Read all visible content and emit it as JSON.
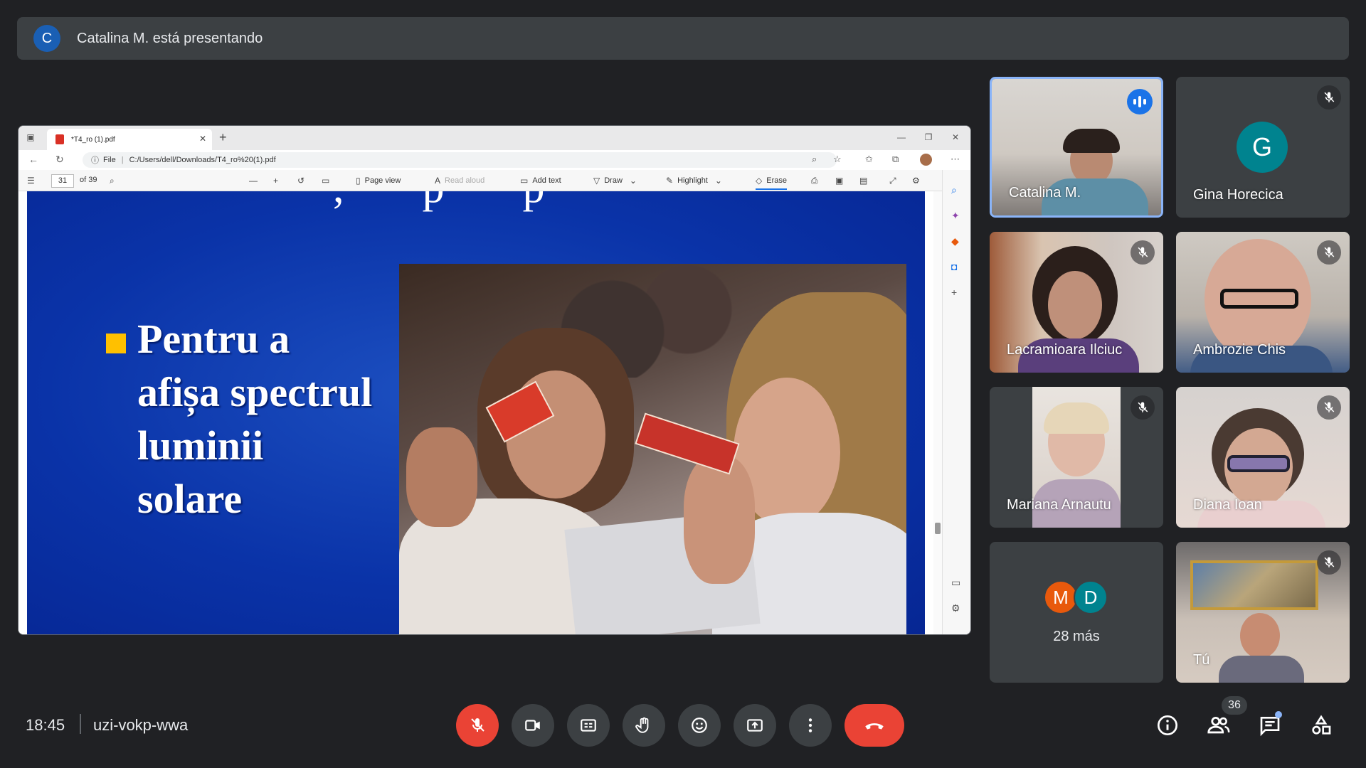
{
  "banner": {
    "avatar_letter": "C",
    "text": "Catalina M. está presentando"
  },
  "browser": {
    "tab_title": "*T4_ro (1).pdf",
    "address_prefix": "File",
    "address_url": "C:/Users/dell/Downloads/T4_ro%20(1).pdf"
  },
  "pdf_toolbar": {
    "page_current": "31",
    "page_total": "of 39",
    "page_view": "Page view",
    "read_aloud": "Read aloud",
    "add_text": "Add text",
    "draw": "Draw",
    "highlight": "Highlight",
    "erase": "Erase"
  },
  "slide": {
    "lines": [
      "Pentru a",
      "afișa spectrul",
      "luminii",
      "solare"
    ]
  },
  "participants": [
    {
      "name": "Catalina M.",
      "speaking": true,
      "muted": false
    },
    {
      "name": "Gina Horecica",
      "avatar_letter": "G",
      "muted": true
    },
    {
      "name": "Lacramioara Ilciuc",
      "muted": true
    },
    {
      "name": "Ambrozie Chis",
      "muted": true
    },
    {
      "name": "Mariana Arnautu",
      "muted": true
    },
    {
      "name": "Diana Ioan",
      "muted": true
    },
    {
      "name": "Tú",
      "muted": true
    }
  ],
  "more": {
    "letters": [
      "M",
      "D"
    ],
    "text": "28 más"
  },
  "meeting": {
    "time": "18:45",
    "code": "uzi-vokp-wwa",
    "people_count": "36"
  },
  "colors": {
    "accent": "#8ab4f8",
    "danger": "#ea4335",
    "surface": "#3c4043",
    "background": "#202124"
  },
  "icons": [
    "mic-off-icon",
    "camera-icon",
    "captions-icon",
    "raise-hand-icon",
    "emoji-icon",
    "present-icon",
    "more-vert-icon",
    "call-end-icon",
    "info-icon",
    "people-icon",
    "chat-icon",
    "activities-icon"
  ]
}
